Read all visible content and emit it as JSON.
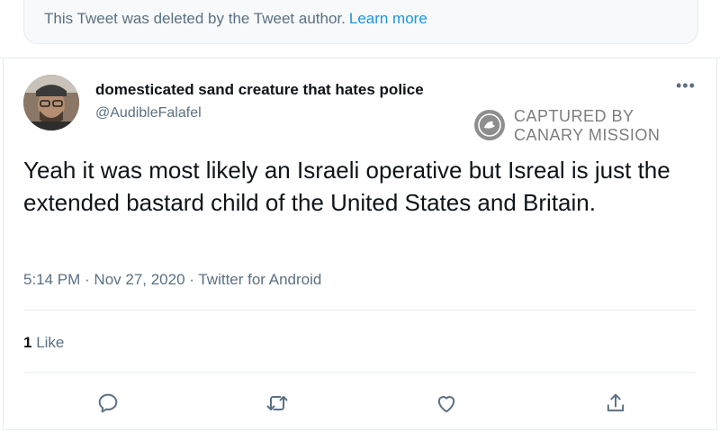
{
  "deleted_notice": {
    "text": "This Tweet was deleted by the Tweet author.",
    "link": "Learn more"
  },
  "author": {
    "display_name": "domesticated sand creature that hates police",
    "handle": "@AudibleFalafel"
  },
  "watermark": {
    "line1": "CAPTURED BY",
    "line2": "CANARY MISSION"
  },
  "tweet": {
    "text": "Yeah it was most likely an Israeli operative but Isreal is just the extended bastard child of the United States and Britain.",
    "meta": "5:14 PM · Nov 27, 2020 · Twitter for Android"
  },
  "engagement": {
    "like_count": "1",
    "like_label": "Like"
  },
  "actions": [
    "reply-icon",
    "retweet-icon",
    "like-icon",
    "share-icon"
  ],
  "colors": {
    "link": "#1b95e0",
    "secondary_text": "#5b7083",
    "primary_text": "#0f1419",
    "border": "#e6ecf0"
  }
}
